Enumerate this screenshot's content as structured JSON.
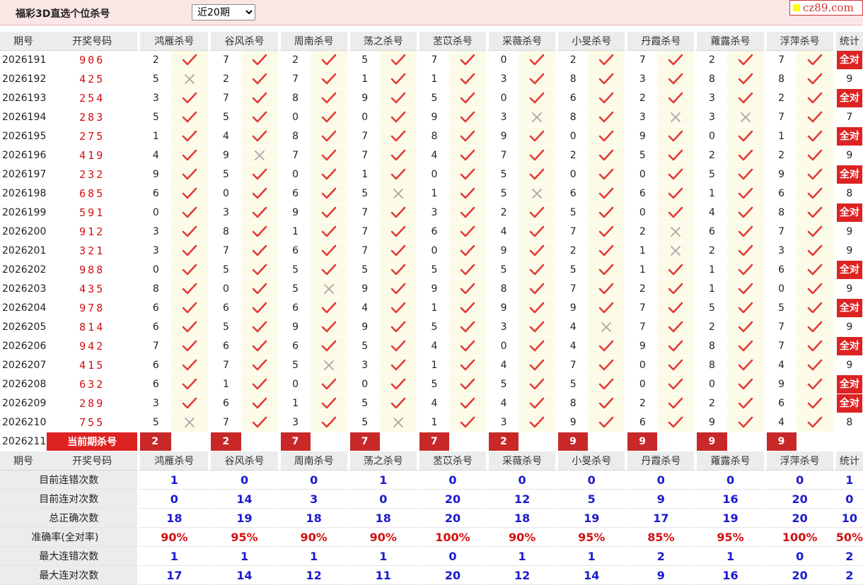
{
  "title": "福彩3D直选个位杀号",
  "select": {
    "options": [
      "近20期"
    ],
    "selected": "近20期"
  },
  "logo": "cz89.com",
  "header": {
    "period": "期号",
    "draw": "开奖号码",
    "experts": [
      "鸿雁杀号",
      "谷风杀号",
      "周南杀号",
      "荡之杀号",
      "苤苡杀号",
      "采薇杀号",
      "小旻杀号",
      "丹霞杀号",
      "蕹露杀号",
      "浮萍杀号"
    ],
    "total": "统计"
  },
  "rows": [
    {
      "period": "2026191",
      "draw": "906",
      "kills": [
        2,
        7,
        2,
        5,
        7,
        0,
        2,
        7,
        2,
        7
      ],
      "hits": [
        1,
        1,
        1,
        1,
        1,
        1,
        1,
        1,
        1,
        1
      ],
      "total": "全对"
    },
    {
      "period": "2026192",
      "draw": "425",
      "kills": [
        5,
        2,
        7,
        1,
        1,
        3,
        8,
        3,
        8,
        8
      ],
      "hits": [
        0,
        1,
        1,
        1,
        1,
        1,
        1,
        1,
        1,
        1
      ],
      "total": "9"
    },
    {
      "period": "2026193",
      "draw": "254",
      "kills": [
        3,
        7,
        8,
        9,
        5,
        0,
        6,
        2,
        3,
        2
      ],
      "hits": [
        1,
        1,
        1,
        1,
        1,
        1,
        1,
        1,
        1,
        1
      ],
      "total": "全对"
    },
    {
      "period": "2026194",
      "draw": "283",
      "kills": [
        5,
        5,
        0,
        0,
        9,
        3,
        8,
        3,
        3,
        7
      ],
      "hits": [
        1,
        1,
        1,
        1,
        1,
        0,
        1,
        0,
        0,
        1
      ],
      "total": "7"
    },
    {
      "period": "2026195",
      "draw": "275",
      "kills": [
        1,
        4,
        8,
        7,
        8,
        9,
        0,
        9,
        0,
        1
      ],
      "hits": [
        1,
        1,
        1,
        1,
        1,
        1,
        1,
        1,
        1,
        1
      ],
      "total": "全对"
    },
    {
      "period": "2026196",
      "draw": "419",
      "kills": [
        4,
        9,
        7,
        7,
        4,
        7,
        2,
        5,
        2,
        2
      ],
      "hits": [
        1,
        0,
        1,
        1,
        1,
        1,
        1,
        1,
        1,
        1
      ],
      "total": "9"
    },
    {
      "period": "2026197",
      "draw": "232",
      "kills": [
        9,
        5,
        0,
        1,
        0,
        5,
        0,
        0,
        5,
        9
      ],
      "hits": [
        1,
        1,
        1,
        1,
        1,
        1,
        1,
        1,
        1,
        1
      ],
      "total": "全对"
    },
    {
      "period": "2026198",
      "draw": "685",
      "kills": [
        6,
        0,
        6,
        5,
        1,
        5,
        6,
        6,
        1,
        6
      ],
      "hits": [
        1,
        1,
        1,
        0,
        1,
        0,
        1,
        1,
        1,
        1
      ],
      "total": "8"
    },
    {
      "period": "2026199",
      "draw": "591",
      "kills": [
        0,
        3,
        9,
        7,
        3,
        2,
        5,
        0,
        4,
        8
      ],
      "hits": [
        1,
        1,
        1,
        1,
        1,
        1,
        1,
        1,
        1,
        1
      ],
      "total": "全对"
    },
    {
      "period": "2026200",
      "draw": "912",
      "kills": [
        3,
        8,
        1,
        7,
        6,
        4,
        7,
        2,
        6,
        7
      ],
      "hits": [
        1,
        1,
        1,
        1,
        1,
        1,
        1,
        0,
        1,
        1
      ],
      "total": "9"
    },
    {
      "period": "2026201",
      "draw": "321",
      "kills": [
        3,
        7,
        6,
        7,
        0,
        9,
        2,
        1,
        2,
        3
      ],
      "hits": [
        1,
        1,
        1,
        1,
        1,
        1,
        1,
        0,
        1,
        1
      ],
      "total": "9"
    },
    {
      "period": "2026202",
      "draw": "988",
      "kills": [
        0,
        5,
        5,
        5,
        5,
        5,
        5,
        1,
        1,
        6
      ],
      "hits": [
        1,
        1,
        1,
        1,
        1,
        1,
        1,
        1,
        1,
        1
      ],
      "total": "全对"
    },
    {
      "period": "2026203",
      "draw": "435",
      "kills": [
        8,
        0,
        5,
        9,
        9,
        8,
        7,
        2,
        1,
        0
      ],
      "hits": [
        1,
        1,
        0,
        1,
        1,
        1,
        1,
        1,
        1,
        1
      ],
      "total": "9"
    },
    {
      "period": "2026204",
      "draw": "978",
      "kills": [
        6,
        6,
        6,
        4,
        1,
        9,
        9,
        7,
        5,
        5
      ],
      "hits": [
        1,
        1,
        1,
        1,
        1,
        1,
        1,
        1,
        1,
        1
      ],
      "total": "全对"
    },
    {
      "period": "2026205",
      "draw": "814",
      "kills": [
        6,
        5,
        9,
        9,
        5,
        3,
        4,
        7,
        2,
        7
      ],
      "hits": [
        1,
        1,
        1,
        1,
        1,
        1,
        0,
        1,
        1,
        1
      ],
      "total": "9"
    },
    {
      "period": "2026206",
      "draw": "942",
      "kills": [
        7,
        6,
        6,
        5,
        4,
        0,
        4,
        9,
        8,
        7
      ],
      "hits": [
        1,
        1,
        1,
        1,
        1,
        1,
        1,
        1,
        1,
        1
      ],
      "total": "全对"
    },
    {
      "period": "2026207",
      "draw": "415",
      "kills": [
        6,
        7,
        5,
        3,
        1,
        4,
        7,
        0,
        8,
        4
      ],
      "hits": [
        1,
        1,
        0,
        1,
        1,
        1,
        1,
        1,
        1,
        1
      ],
      "total": "9"
    },
    {
      "period": "2026208",
      "draw": "632",
      "kills": [
        6,
        1,
        0,
        0,
        5,
        5,
        5,
        0,
        0,
        9
      ],
      "hits": [
        1,
        1,
        1,
        1,
        1,
        1,
        1,
        1,
        1,
        1
      ],
      "total": "全对"
    },
    {
      "period": "2026209",
      "draw": "289",
      "kills": [
        3,
        6,
        1,
        5,
        4,
        4,
        8,
        2,
        2,
        6
      ],
      "hits": [
        1,
        1,
        1,
        1,
        1,
        1,
        1,
        1,
        1,
        1
      ],
      "total": "全对"
    },
    {
      "period": "2026210",
      "draw": "755",
      "kills": [
        5,
        7,
        3,
        5,
        1,
        3,
        9,
        6,
        9,
        4
      ],
      "hits": [
        0,
        1,
        1,
        0,
        1,
        1,
        1,
        1,
        1,
        1
      ],
      "total": "8"
    }
  ],
  "current": {
    "period": "2026211",
    "label": "当前期杀号",
    "kills": [
      2,
      2,
      7,
      7,
      7,
      2,
      9,
      9,
      9,
      9
    ]
  },
  "stats": [
    {
      "label": "目前连错次数",
      "color": "blue",
      "values": [
        "1",
        "0",
        "0",
        "1",
        "0",
        "0",
        "0",
        "0",
        "0",
        "0"
      ],
      "total": "1"
    },
    {
      "label": "目前连对次数",
      "color": "blue",
      "values": [
        "0",
        "14",
        "3",
        "0",
        "20",
        "12",
        "5",
        "9",
        "16",
        "20"
      ],
      "total": "0"
    },
    {
      "label": "总正确次数",
      "color": "blue",
      "values": [
        "18",
        "19",
        "18",
        "18",
        "20",
        "18",
        "19",
        "17",
        "19",
        "20"
      ],
      "total": "10"
    },
    {
      "label": "准确率(全对率)",
      "color": "red",
      "values": [
        "90%",
        "95%",
        "90%",
        "90%",
        "100%",
        "90%",
        "95%",
        "85%",
        "95%",
        "100%"
      ],
      "total": "50%"
    },
    {
      "label": "最大连错次数",
      "color": "blue",
      "values": [
        "1",
        "1",
        "1",
        "1",
        "0",
        "1",
        "1",
        "2",
        "1",
        "0"
      ],
      "total": "2"
    },
    {
      "label": "最大连对次数",
      "color": "blue",
      "values": [
        "17",
        "14",
        "12",
        "11",
        "20",
        "12",
        "14",
        "9",
        "16",
        "20"
      ],
      "total": "2"
    }
  ],
  "colors": {
    "accent": "#dd2222",
    "check": "#e23a3a",
    "cross": "#a8a8a8",
    "stat_blue": "#1a1ad0",
    "stat_red": "#d21010"
  },
  "icons": {
    "hit": "check-icon",
    "miss": "cross-icon"
  }
}
